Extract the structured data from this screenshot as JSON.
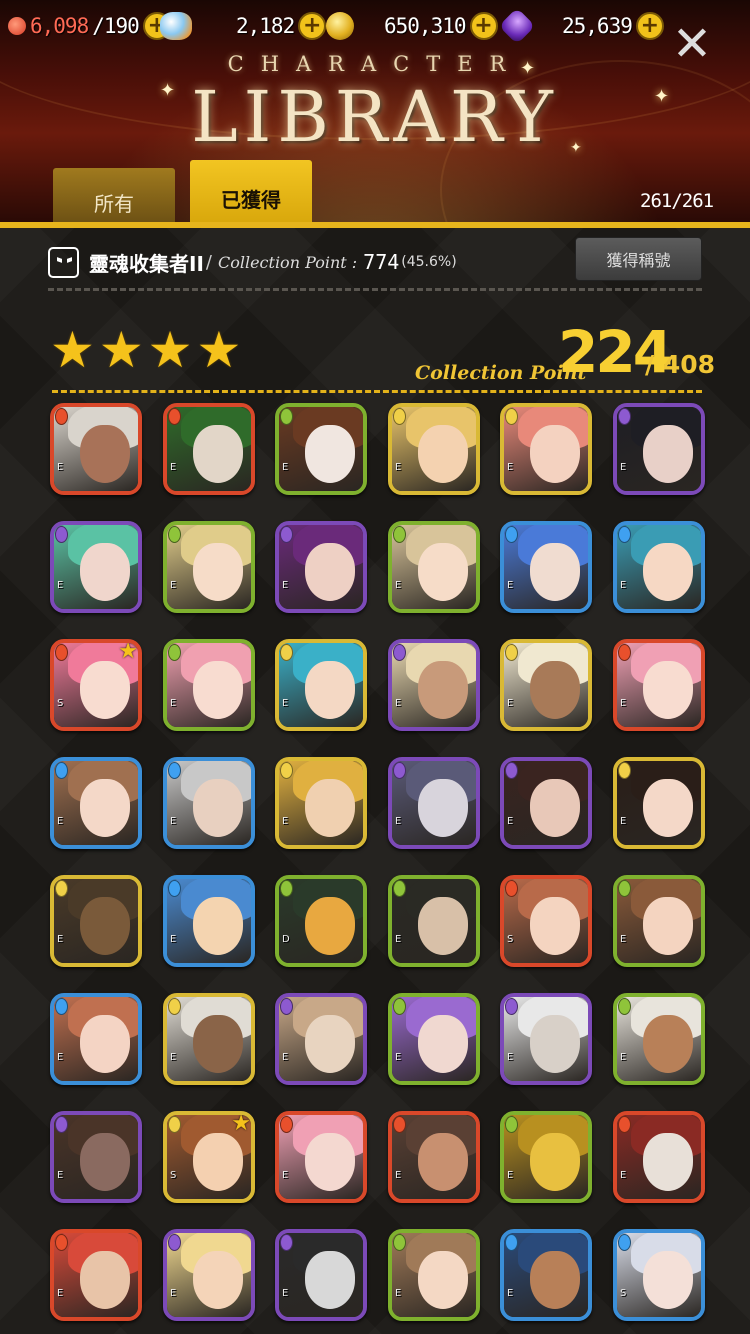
{
  "currencies": [
    {
      "name": "stamina",
      "icon": "heart-icon",
      "value": "6,098",
      "max": "/190",
      "color": "#ff6a55"
    },
    {
      "name": "crystal",
      "icon": "crystal-icon",
      "value": "2,182"
    },
    {
      "name": "gold",
      "icon": "gold-coin-icon",
      "value": "650,310"
    },
    {
      "name": "gem",
      "icon": "purple-gem-icon",
      "value": "25,639"
    }
  ],
  "header": {
    "subtitle": "CHARACTER",
    "title": "LIBRARY",
    "close": "✕"
  },
  "tabs": {
    "all": "所有",
    "owned": "已獲得",
    "active": "owned"
  },
  "count": "261/261",
  "achievement": {
    "name": "靈魂收集者II",
    "separator": "/",
    "cp_label": "Collection Point :",
    "cp_value": "774",
    "cp_percent": "(45.6%)",
    "button": "獲得稱號"
  },
  "tier": {
    "stars": 4,
    "star_glyph": "★",
    "cp_label": "Collection Point",
    "cp_value": "224",
    "cp_max": "/ 408"
  },
  "cards": [
    {
      "element": "fire",
      "rank": "E",
      "skin": "#a87258",
      "hair": "#d9d4cc"
    },
    {
      "element": "fire",
      "rank": "E",
      "skin": "#e2d6c8",
      "hair": "#2f6b2a"
    },
    {
      "element": "earth",
      "rank": "E",
      "skin": "#f0e6e0",
      "hair": "#6a3a22"
    },
    {
      "element": "light",
      "rank": "E",
      "skin": "#f4d2b0",
      "hair": "#e8c46a"
    },
    {
      "element": "light",
      "rank": "E",
      "skin": "#f4d2c0",
      "hair": "#e8897a"
    },
    {
      "element": "dark",
      "rank": "E",
      "skin": "#e8d0c8",
      "hair": "#1e1e24"
    },
    {
      "element": "dark",
      "rank": "E",
      "skin": "#f0d6cc",
      "hair": "#5ac2a4"
    },
    {
      "element": "earth",
      "rank": "E",
      "skin": "#f6dcc8",
      "hair": "#e0cc8a"
    },
    {
      "element": "dark",
      "rank": "E",
      "skin": "#eed0c4",
      "hair": "#6a2a7a"
    },
    {
      "element": "earth",
      "rank": "E",
      "skin": "#f6dcc8",
      "hair": "#d8c49a"
    },
    {
      "element": "water",
      "rank": "E",
      "skin": "#f0dcd0",
      "hair": "#4a7ad8"
    },
    {
      "element": "water",
      "rank": "E",
      "skin": "#f6d8c4",
      "hair": "#3a9cb4"
    },
    {
      "element": "fire",
      "rank": "S",
      "skin": "#f8dcd0",
      "hair": "#f07a9a",
      "star": true
    },
    {
      "element": "earth",
      "rank": "E",
      "skin": "#f8dcd0",
      "hair": "#f0a0b0"
    },
    {
      "element": "light",
      "rank": "E",
      "skin": "#f4d8c4",
      "hair": "#3ab0c8"
    },
    {
      "element": "dark",
      "rank": "E",
      "skin": "#c89a7a",
      "hair": "#e8d8b0"
    },
    {
      "element": "light",
      "rank": "E",
      "skin": "#a87a58",
      "hair": "#f0e8d0"
    },
    {
      "element": "fire",
      "rank": "E",
      "skin": "#f8dcd0",
      "hair": "#f0a0b4"
    },
    {
      "element": "water",
      "rank": "E",
      "skin": "#f4d8c8",
      "hair": "#a07050"
    },
    {
      "element": "water",
      "rank": "E",
      "skin": "#e8d0c0",
      "hair": "#c8c8c8"
    },
    {
      "element": "light",
      "rank": "E",
      "skin": "#f0d0b0",
      "hair": "#e0b040"
    },
    {
      "element": "dark",
      "rank": "E",
      "skin": "#d8d4dc",
      "hair": "#5a5a78"
    },
    {
      "element": "dark",
      "rank": "E",
      "skin": "#e8c8b8",
      "hair": "#3a2420"
    },
    {
      "element": "light",
      "rank": "E",
      "skin": "#f4d8c8",
      "hair": "#2a1e18"
    },
    {
      "element": "light",
      "rank": "E",
      "skin": "#7a5a3a",
      "hair": "#4a3a28"
    },
    {
      "element": "water",
      "rank": "E",
      "skin": "#f4d4b0",
      "hair": "#4a8ad0"
    },
    {
      "element": "earth",
      "rank": "D",
      "skin": "#e8a840",
      "hair": "#2a3a2a"
    },
    {
      "element": "earth",
      "rank": "E",
      "skin": "#d8c0a8",
      "hair": "#2a2a24"
    },
    {
      "element": "fire",
      "rank": "S",
      "skin": "#f4d4c0",
      "hair": "#b86a4a"
    },
    {
      "element": "earth",
      "rank": "E",
      "skin": "#f4d4c0",
      "hair": "#8a5a3a"
    },
    {
      "element": "water",
      "rank": "E",
      "skin": "#f4d4c4",
      "hair": "#c07050"
    },
    {
      "element": "light",
      "rank": "E",
      "skin": "#8a6448",
      "hair": "#e0dcd4"
    },
    {
      "element": "dark",
      "rank": "E",
      "skin": "#e8d4c0",
      "hair": "#c8a888"
    },
    {
      "element": "earth",
      "rank": "E",
      "skin": "#f0d8d0",
      "hair": "#9a6ad0"
    },
    {
      "element": "dark",
      "rank": "E",
      "skin": "#d8d0c8",
      "hair": "#e8e8e8"
    },
    {
      "element": "earth",
      "rank": "E",
      "skin": "#b88058",
      "hair": "#e8e4dc"
    },
    {
      "element": "dark",
      "rank": "E",
      "skin": "#8a6a60",
      "hair": "#4a3428"
    },
    {
      "element": "light",
      "rank": "S",
      "skin": "#f4d0b0",
      "hair": "#a05a30",
      "star": true
    },
    {
      "element": "fire",
      "rank": "E",
      "skin": "#f4d8d0",
      "hair": "#f0a0b4"
    },
    {
      "element": "fire",
      "rank": "E",
      "skin": "#c89070",
      "hair": "#5a4034"
    },
    {
      "element": "earth",
      "rank": "E",
      "skin": "#e8c040",
      "hair": "#b89020"
    },
    {
      "element": "fire",
      "rank": "E",
      "skin": "#e8e0d8",
      "hair": "#8a2a24"
    },
    {
      "element": "fire",
      "rank": "E",
      "skin": "#e8c4a8",
      "hair": "#d84a3a"
    },
    {
      "element": "dark",
      "rank": "E",
      "skin": "#f4d4b8",
      "hair": "#f0d890"
    },
    {
      "element": "dark",
      "rank": "E",
      "skin": "#d8d8d8",
      "hair": "#2a2a2a"
    },
    {
      "element": "earth",
      "rank": "E",
      "skin": "#f4d8c4",
      "hair": "#a07a58"
    },
    {
      "element": "water",
      "rank": "E",
      "skin": "#b88058",
      "hair": "#2a4a7a"
    },
    {
      "element": "water",
      "rank": "S",
      "skin": "#f4e0d8",
      "hair": "#d8dce8"
    }
  ]
}
